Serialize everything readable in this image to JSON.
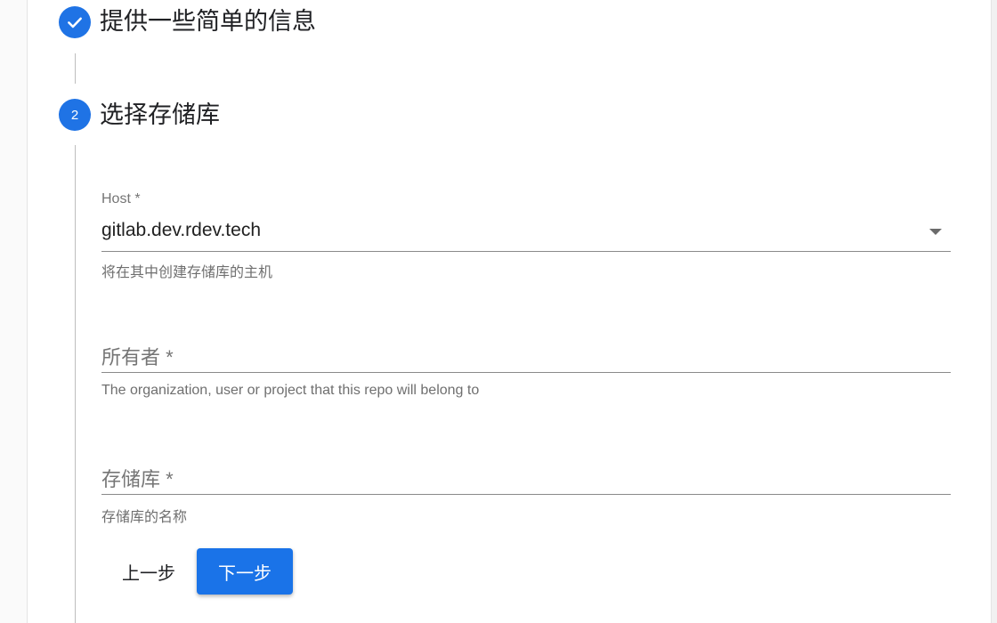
{
  "stepper": {
    "steps": [
      {
        "number": "",
        "title": "提供一些简单的信息",
        "state": "completed",
        "icon": "check-icon"
      },
      {
        "number": "2",
        "title": "选择存储库",
        "state": "active"
      }
    ]
  },
  "form": {
    "host": {
      "label": "Host *",
      "value": "gitlab.dev.rdev.tech",
      "helper": "将在其中创建存储库的主机",
      "icon": "dropdown-arrow-icon"
    },
    "owner": {
      "label": "所有者 *",
      "helper": "The organization, user or project that this repo will belong to"
    },
    "repository": {
      "label": "存储库 *",
      "helper": "存储库的名称"
    }
  },
  "actions": {
    "back_label": "上一步",
    "next_label": "下一步"
  },
  "colors": {
    "primary": "#1a73e8",
    "text": "#202124",
    "muted": "#757575"
  }
}
